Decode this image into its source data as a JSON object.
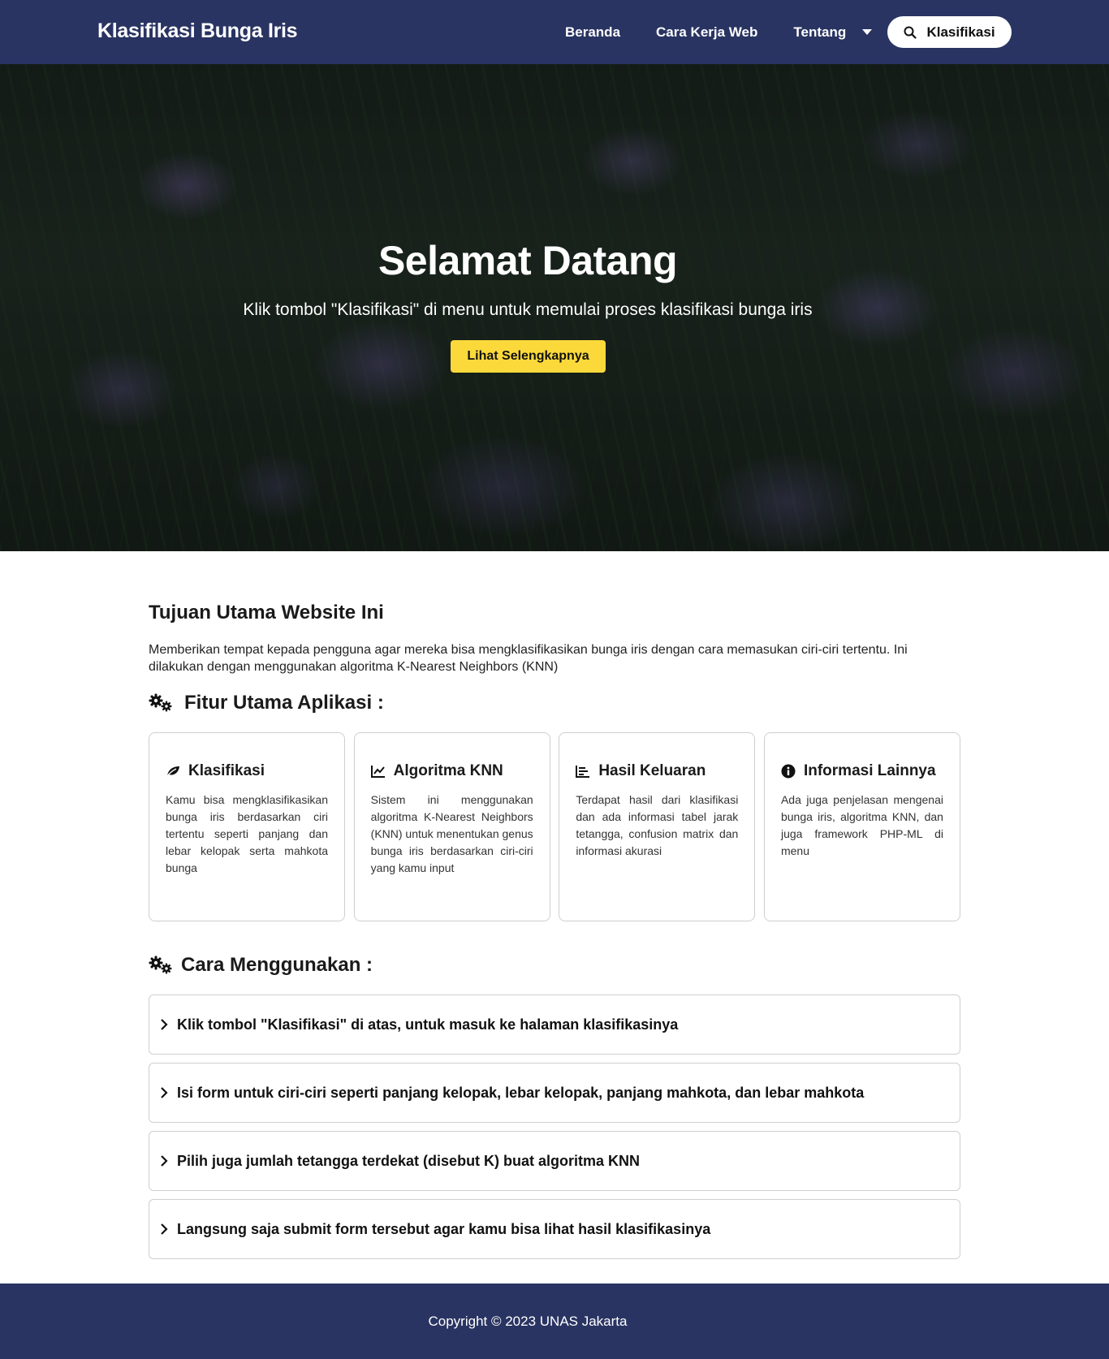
{
  "navbar": {
    "brand": "Klasifikasi Bunga Iris",
    "links": [
      "Beranda",
      "Cara Kerja Web"
    ],
    "dropdown_label": "Tentang",
    "classify_button": "Klasifikasi",
    "background_color": "#293462"
  },
  "hero": {
    "title": "Selamat Datang",
    "subtitle": "Klik tombol \"Klasifikasi\" di menu untuk memulai proses klasifikasi bunga iris",
    "button": "Lihat Selengkapnya",
    "button_color": "#fbd93b"
  },
  "intro": {
    "title": "Tujuan Utama Website Ini",
    "description": "Memberikan tempat kepada pengguna agar mereka bisa mengklasifikasikan bunga iris dengan cara memasukan ciri-ciri tertentu. Ini dilakukan dengan menggunakan algoritma K-Nearest Neighbors (KNN)"
  },
  "features": {
    "title": "Fitur Utama Aplikasi :",
    "icon": "gears-icon",
    "cards": [
      {
        "icon": "leaf-icon",
        "title": "Klasifikasi",
        "text": "Kamu bisa mengklasifikasikan bunga iris berdasarkan ciri tertentu seperti panjang dan lebar kelopak serta mahkota bunga"
      },
      {
        "icon": "line-chart-icon",
        "title": "Algoritma KNN",
        "text": "Sistem ini menggunakan algoritma K-Nearest Neighbors (KNN) untuk menentukan genus bunga iris berdasarkan ciri-ciri yang kamu input"
      },
      {
        "icon": "bar-chart-icon",
        "title": "Hasil Keluaran",
        "text": "Terdapat hasil dari klasifikasi dan ada informasi tabel jarak tetangga, confusion matrix dan informasi akurasi"
      },
      {
        "icon": "info-circle-icon",
        "title": "Informasi Lainnya",
        "text": "Ada juga penjelasan mengenai bunga iris, algoritma KNN, dan juga framework PHP-ML di menu"
      }
    ]
  },
  "usage": {
    "title": "Cara Menggunakan :",
    "icon": "gears-icon",
    "steps": [
      "Klik tombol \"Klasifikasi\" di atas, untuk masuk ke halaman klasifikasinya",
      "Isi form untuk ciri-ciri seperti panjang kelopak, lebar kelopak, panjang mahkota, dan lebar mahkota",
      "Pilih juga jumlah tetangga terdekat (disebut K) buat algoritma KNN",
      "Langsung saja submit form tersebut agar kamu bisa lihat hasil klasifikasinya"
    ]
  },
  "footer": {
    "copyright": "Copyright © 2023 UNAS Jakarta"
  }
}
